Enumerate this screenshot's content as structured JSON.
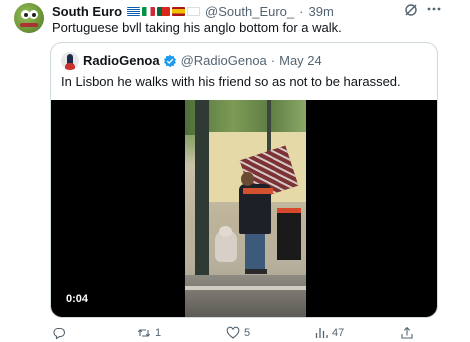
{
  "tweet": {
    "author_name": "South Euro",
    "author_handle": "@South_Euro_",
    "separator": "·",
    "age": "39m",
    "text": "Portuguese bvll taking his anglo bottom for a walk."
  },
  "quoted_tweet": {
    "author_name": "RadioGenoa",
    "author_handle": "@RadioGenoa",
    "separator": "·",
    "date": "May 24",
    "text": "In Lisbon he walks with his friend so as not to be harassed.",
    "video_timestamp": "0:04"
  },
  "actions": {
    "reply_count": "",
    "retweet_count": "1",
    "like_count": "5",
    "views_count": "47"
  },
  "icons": {
    "grok": "grok-slash-icon",
    "more": "more-dots-icon",
    "verified": "verified-badge-icon",
    "reply": "reply-icon",
    "retweet": "retweet-icon",
    "like": "heart-icon",
    "views": "views-icon",
    "share": "share-icon"
  },
  "colors": {
    "text_primary": "#0f1419",
    "text_secondary": "#536471",
    "verified_blue": "#1d9bf0",
    "border": "#cfd9de"
  }
}
